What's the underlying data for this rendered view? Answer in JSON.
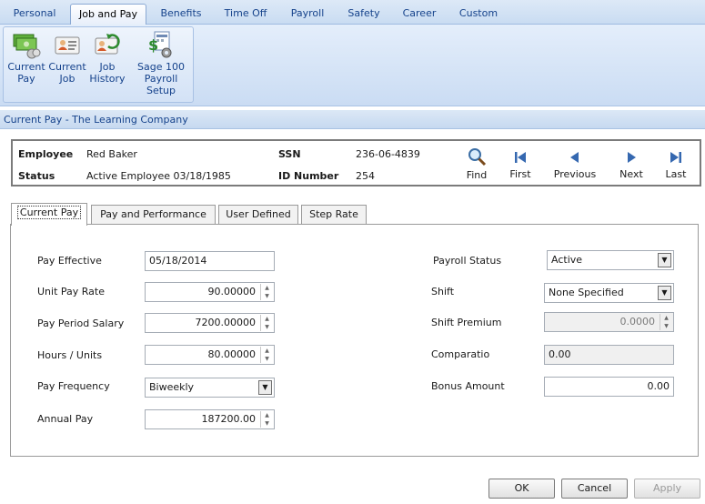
{
  "ribbon": {
    "tabs": [
      "Personal",
      "Job and Pay",
      "Benefits",
      "Time Off",
      "Payroll",
      "Safety",
      "Career",
      "Custom"
    ],
    "buttons": [
      {
        "line1": "Current",
        "line2": "Pay",
        "icon": "money-icon"
      },
      {
        "line1": "Current",
        "line2": "Job",
        "icon": "id-card-icon"
      },
      {
        "line1": "Job",
        "line2": "History",
        "icon": "history-card-icon"
      },
      {
        "line1": "Sage 100",
        "line2": "Payroll Setup",
        "icon": "payroll-setup-icon"
      }
    ]
  },
  "subtitle": "Current Pay - The Learning Company",
  "employee": {
    "employee_label": "Employee",
    "employee_value": "Red Baker",
    "status_label": "Status",
    "status_value": "Active Employee 03/18/1985",
    "ssn_label": "SSN",
    "ssn_value": "236-06-4839",
    "id_label": "ID Number",
    "id_value": "254"
  },
  "nav": {
    "find": "Find",
    "first": "First",
    "previous": "Previous",
    "next": "Next",
    "last": "Last"
  },
  "tabs": [
    "Current Pay",
    "Pay and Performance",
    "User Defined",
    "Step Rate"
  ],
  "form": {
    "pay_effective_label": "Pay Effective",
    "pay_effective_value": "05/18/2014",
    "unit_pay_rate_label": "Unit Pay Rate",
    "unit_pay_rate_value": "90.00000",
    "pay_period_salary_label": "Pay Period Salary",
    "pay_period_salary_value": "7200.00000",
    "hours_units_label": "Hours / Units",
    "hours_units_value": "80.00000",
    "pay_frequency_label": "Pay Frequency",
    "pay_frequency_value": "Biweekly",
    "annual_pay_label": "Annual Pay",
    "annual_pay_value": "187200.00",
    "payroll_status_label": "Payroll Status",
    "payroll_status_value": "Active",
    "shift_label": "Shift",
    "shift_value": "None Specified",
    "shift_premium_label": "Shift Premium",
    "shift_premium_value": "0.0000",
    "comparatio_label": "Comparatio",
    "comparatio_value": "0.00",
    "bonus_amount_label": "Bonus Amount",
    "bonus_amount_value": "0.00"
  },
  "buttons": {
    "ok": "OK",
    "cancel": "Cancel",
    "apply": "Apply"
  }
}
